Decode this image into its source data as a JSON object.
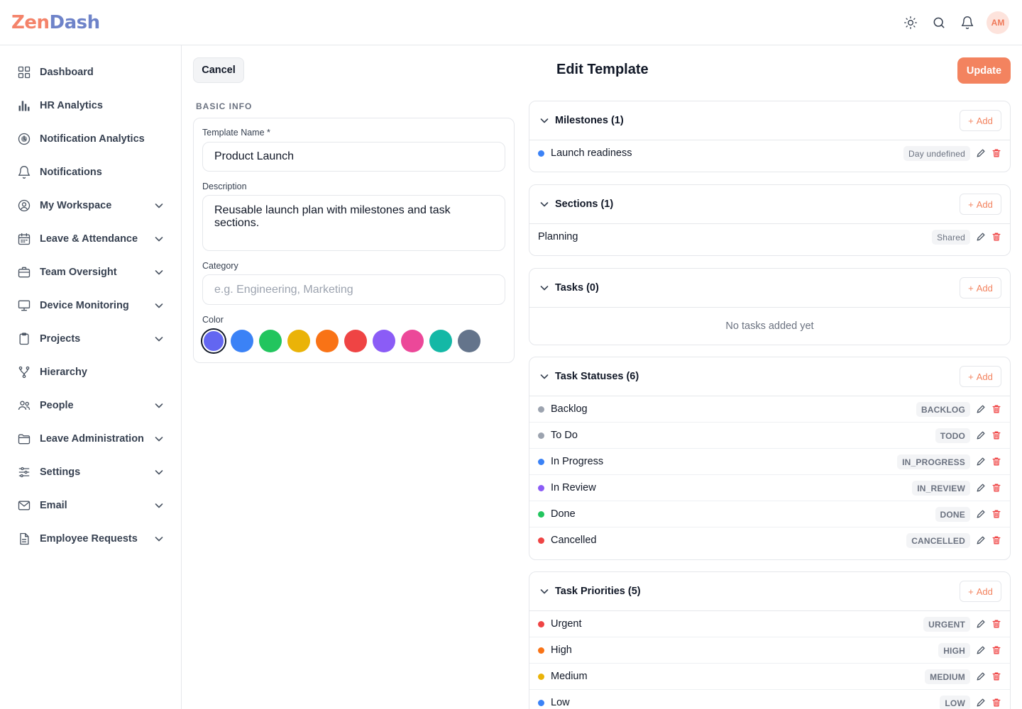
{
  "app": {
    "logo_part1": "Zen",
    "logo_part2": "Dash",
    "user_initials": "AM"
  },
  "header_icons": [
    "sun-icon",
    "search-icon",
    "bell-icon"
  ],
  "sidebar": {
    "items": [
      {
        "label": "Dashboard",
        "icon": "grid-icon",
        "expandable": false
      },
      {
        "label": "HR Analytics",
        "icon": "bar-chart-icon",
        "expandable": false
      },
      {
        "label": "Notification Analytics",
        "icon": "notification-analytics-icon",
        "expandable": false
      },
      {
        "label": "Notifications",
        "icon": "bell-icon",
        "expandable": false
      },
      {
        "label": "My Workspace",
        "icon": "user-circle-icon",
        "expandable": true
      },
      {
        "label": "Leave & Attendance",
        "icon": "calendar-icon",
        "expandable": true
      },
      {
        "label": "Team Oversight",
        "icon": "briefcase-icon",
        "expandable": true
      },
      {
        "label": "Device Monitoring",
        "icon": "monitor-icon",
        "expandable": true
      },
      {
        "label": "Projects",
        "icon": "clipboard-icon",
        "expandable": true
      },
      {
        "label": "Hierarchy",
        "icon": "hierarchy-icon",
        "expandable": false
      },
      {
        "label": "People",
        "icon": "people-icon",
        "expandable": true
      },
      {
        "label": "Leave Administration",
        "icon": "folder-icon",
        "expandable": true
      },
      {
        "label": "Settings",
        "icon": "sliders-icon",
        "expandable": true
      },
      {
        "label": "Email",
        "icon": "mail-icon",
        "expandable": true
      },
      {
        "label": "Employee Requests",
        "icon": "document-icon",
        "expandable": true
      }
    ]
  },
  "toolbar": {
    "cancel_label": "Cancel",
    "title": "Edit Template",
    "update_label": "Update"
  },
  "basic_info": {
    "section_label": "BASIC INFO",
    "template_name_label": "Template Name *",
    "template_name_value": "Product Launch",
    "description_label": "Description",
    "description_value": "Reusable launch plan with milestones and task sections.",
    "category_label": "Category",
    "category_placeholder": "e.g. Engineering, Marketing",
    "color_label": "Color",
    "colors": [
      "#6366f1",
      "#3b82f6",
      "#22c55e",
      "#eab308",
      "#f97316",
      "#ef4444",
      "#8b5cf6",
      "#ec4899",
      "#14b8a6",
      "#64748b"
    ],
    "selected_color": "#6366f1"
  },
  "add_label": "Add",
  "milestones": {
    "title": "Milestones (1)",
    "items": [
      {
        "label": "Launch readiness",
        "badge": "Day undefined",
        "color": "#3b82f6"
      }
    ]
  },
  "sections": {
    "title": "Sections (1)",
    "items": [
      {
        "label": "Planning",
        "badge": "Shared"
      }
    ]
  },
  "tasks": {
    "title": "Tasks (0)",
    "empty": "No tasks added yet"
  },
  "task_statuses": {
    "title": "Task Statuses (6)",
    "items": [
      {
        "label": "Backlog",
        "badge": "BACKLOG",
        "color": "#9ca3af"
      },
      {
        "label": "To Do",
        "badge": "TODO",
        "color": "#9ca3af"
      },
      {
        "label": "In Progress",
        "badge": "IN_PROGRESS",
        "color": "#3b82f6"
      },
      {
        "label": "In Review",
        "badge": "IN_REVIEW",
        "color": "#8b5cf6"
      },
      {
        "label": "Done",
        "badge": "DONE",
        "color": "#22c55e"
      },
      {
        "label": "Cancelled",
        "badge": "CANCELLED",
        "color": "#ef4444"
      }
    ]
  },
  "task_priorities": {
    "title": "Task Priorities (5)",
    "items": [
      {
        "label": "Urgent",
        "badge": "URGENT",
        "color": "#ef4444"
      },
      {
        "label": "High",
        "badge": "HIGH",
        "color": "#f97316"
      },
      {
        "label": "Medium",
        "badge": "MEDIUM",
        "color": "#eab308"
      },
      {
        "label": "Low",
        "badge": "LOW",
        "color": "#3b82f6"
      }
    ]
  }
}
